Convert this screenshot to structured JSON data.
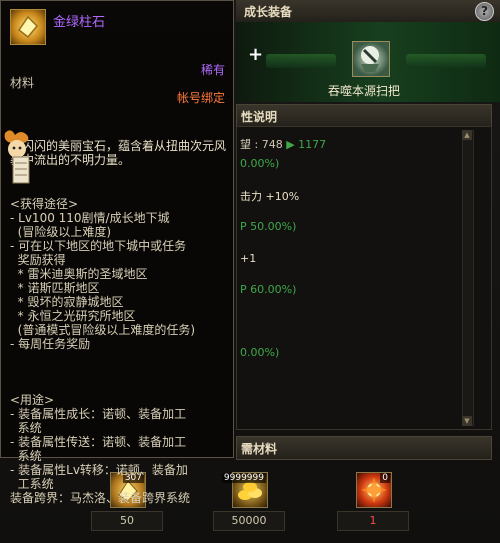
{
  "window": {
    "title": "成长装备",
    "help_icon": "?"
  },
  "scan": {
    "plus": "+",
    "label": "吞噬本源扫把",
    "icon": "broom-icon"
  },
  "attributes": {
    "header": "性说明",
    "lines": [
      {
        "text": "望 : 748",
        "arrow": "▶",
        "value": "1177"
      },
      {
        "text": "0.00%)"
      },
      {
        "text": "击力 +10%"
      },
      {
        "text": "P 50.00%)"
      },
      {
        "text": "+1"
      },
      {
        "text": "P 60.00%)"
      },
      {
        "text": "0.00%)"
      }
    ]
  },
  "materials": {
    "header": "需材料",
    "items": [
      {
        "name": "gold-crystal-icon",
        "badge": "307",
        "value": "50"
      },
      {
        "name": "gold-coins-icon",
        "badge": "9999999",
        "value": "50000"
      },
      {
        "name": "fire-orb-icon",
        "badge": "0",
        "value": "1"
      }
    ]
  },
  "tooltip": {
    "name": "金绿柱石",
    "rarity": "稀有",
    "type": "材料",
    "bind": "帐号绑定",
    "description": "金闪闪的美丽宝石，蕴含着从扭曲次元风暴中流出的不明力量。",
    "obtain": "<获得途径>\n- Lv100 110剧情/成长地下城\n  (冒险级以上难度)\n- 可在以下地区的地下城中或任务\n  奖励获得\n  * 雷米迪奥斯的圣域地区\n  * 诺斯匹斯地区\n  * 毁坏的寂静城地区\n  * 永恒之光研究所地区\n  (普通模式冒险级以上难度的任务)\n- 每周任务奖励",
    "usage": "<用途>\n- 装备属性成长：诺顿、装备加工\n  系统\n- 装备属性传送：诺顿、装备加工\n  系统\n- 装备属性Lv转移：诺顿、装备加\n  工系统\n装备跨界：马杰洛、装备跨界系统"
  },
  "colors": {
    "rarity": "#b06aff",
    "bind": "#ff7a3a",
    "value_red": "#ff4a4a",
    "accent_green": "#3ea84a"
  }
}
